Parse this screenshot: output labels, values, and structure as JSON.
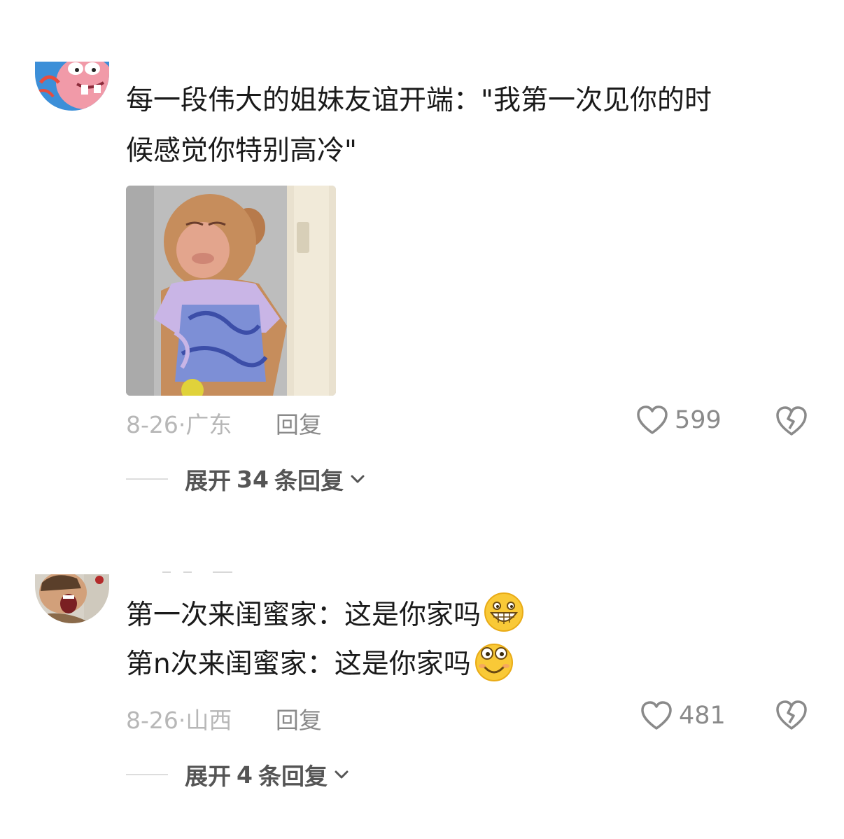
{
  "comments": [
    {
      "lines": [
        "每一段伟大的姐妹友谊开端：\"我第一次见你的时",
        "候感觉你特别高冷\""
      ],
      "date": "8-26",
      "separator": "·",
      "location": "广东",
      "reply_label": "回复",
      "likes": "599",
      "expand_prefix": "展开",
      "expand_count": "34",
      "expand_suffix": "条回复"
    },
    {
      "lines": [
        "第一次来闺蜜家：这是你家吗",
        "第n次来闺蜜家：这是你家吗"
      ],
      "date": "8-26",
      "separator": "·",
      "location": "山西",
      "reply_label": "回复",
      "likes": "481",
      "expand_prefix": "展开",
      "expand_count": "4",
      "expand_suffix": "条回复"
    }
  ],
  "icons": {
    "like": "heart-outline-icon",
    "dislike": "broken-heart-icon",
    "expand": "chevron-down-icon",
    "emoji_1": "grinning-teeth-emoji",
    "emoji_2": "wide-eyed-smile-emoji"
  },
  "colors": {
    "meta_text": "#b7b7b7",
    "action_text": "#8a8a8a",
    "emoji_yellow": "#f9c937"
  }
}
